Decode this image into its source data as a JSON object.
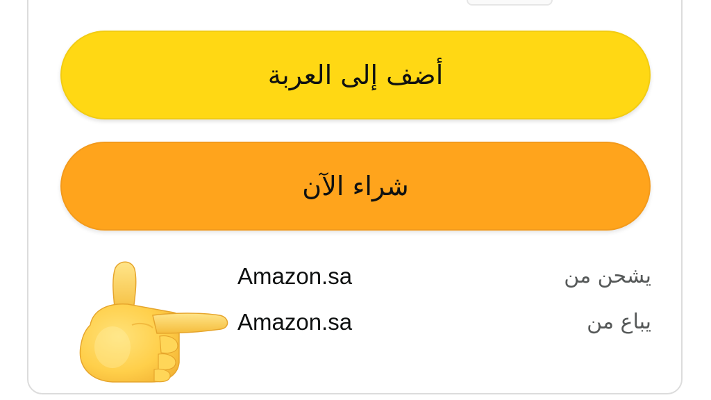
{
  "buttons": {
    "add_to_cart": "أضف إلى العربة",
    "buy_now": "شراء الآن"
  },
  "seller_info": {
    "ships_from_label": "يشحن من",
    "ships_from_value": "Amazon.sa",
    "sold_by_label": "يباع من",
    "sold_by_value": "Amazon.sa"
  },
  "annotation": {
    "icon": "pointing-hand-icon"
  },
  "colors": {
    "add_to_cart_bg": "#ffd814",
    "buy_now_bg": "#ffa41c",
    "text": "#0f1111",
    "muted_text": "#565959",
    "card_border": "#dcdcdc"
  }
}
